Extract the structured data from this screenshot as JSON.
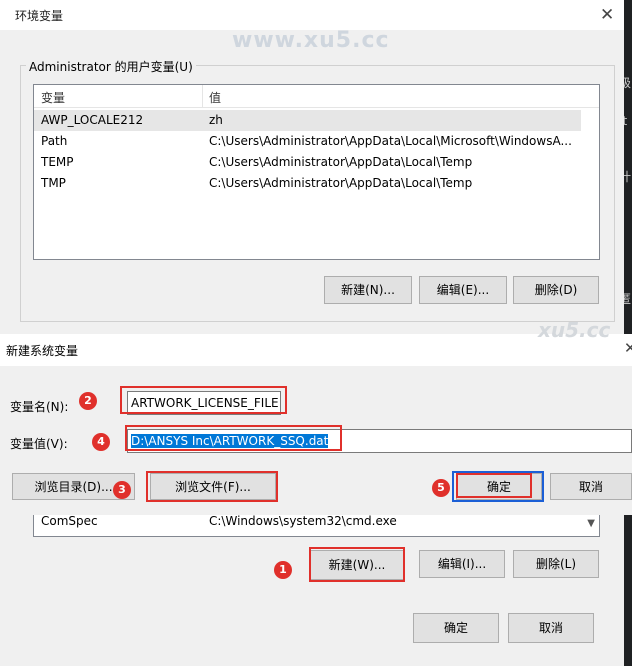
{
  "env_window": {
    "title": "环境变量",
    "watermark": "www.xu5.cc",
    "user_group_label": "Administrator 的用户变量(U)",
    "user_table": {
      "headers": [
        "变量",
        "值"
      ],
      "rows": [
        {
          "name": "AWP_LOCALE212",
          "value": "zh"
        },
        {
          "name": "Path",
          "value": "C:\\Users\\Administrator\\AppData\\Local\\Microsoft\\WindowsA..."
        },
        {
          "name": "TEMP",
          "value": "C:\\Users\\Administrator\\AppData\\Local\\Temp"
        },
        {
          "name": "TMP",
          "value": "C:\\Users\\Administrator\\AppData\\Local\\Temp"
        }
      ]
    },
    "user_buttons": {
      "new": "新建(N)...",
      "edit": "编辑(E)...",
      "delete": "删除(D)"
    },
    "system_row": {
      "name": "ComSpec",
      "value": "C:\\Windows\\system32\\cmd.exe"
    },
    "system_buttons": {
      "new": "新建(W)...",
      "edit": "编辑(I)...",
      "delete": "删除(L)"
    },
    "ok": "确定",
    "cancel": "取消"
  },
  "right_edge_glyphs": [
    "级",
    "It",
    "计",
    "匿"
  ],
  "dialog": {
    "title": "新建系统变量",
    "watermark": "xu5.cc",
    "var_name_label": "变量名(N):",
    "var_name_value": "ARTWORK_LICENSE_FILE",
    "var_value_label": "变量值(V):",
    "var_value_value": "D:\\ANSYS Inc\\ARTWORK_SSQ.dat",
    "browse_dir": "浏览目录(D)...",
    "browse_file": "浏览文件(F)...",
    "ok": "确定",
    "cancel": "取消"
  },
  "annotations": {
    "n1": "1",
    "n2": "2",
    "n3": "3",
    "n4": "4",
    "n5": "5"
  },
  "colors": {
    "annotation_red": "#e0302b",
    "highlight_blue": "#0078d7"
  }
}
